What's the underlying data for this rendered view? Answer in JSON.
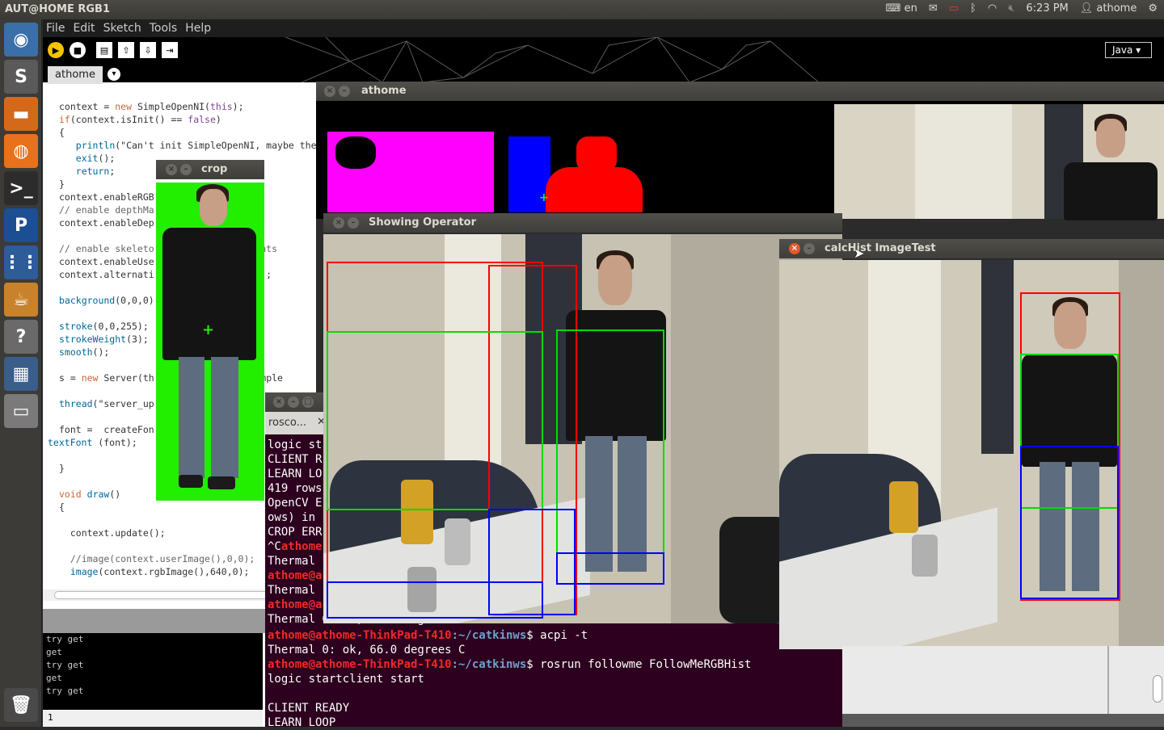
{
  "top_panel": {
    "title": "AUT@HOME RGB1",
    "lang": "en",
    "time": "6:23 PM",
    "user": "athome"
  },
  "launcher": [
    {
      "name": "dash",
      "glyph": "◉",
      "bg": "#3a6fa8"
    },
    {
      "name": "sublime",
      "glyph": "S",
      "bg": "#5a5a5a"
    },
    {
      "name": "files",
      "glyph": "▬",
      "bg": "#d4691c"
    },
    {
      "name": "firefox",
      "glyph": "◍",
      "bg": "#e8711c"
    },
    {
      "name": "terminal",
      "glyph": ">_",
      "bg": "#2c2c2c"
    },
    {
      "name": "processing",
      "glyph": "P",
      "bg": "#1c4e94"
    },
    {
      "name": "apps",
      "glyph": "⋮⋮",
      "bg": "#2d5c98"
    },
    {
      "name": "java",
      "glyph": "☕",
      "bg": "#c9822c"
    },
    {
      "name": "help",
      "glyph": "?",
      "bg": "#6a6a6a"
    },
    {
      "name": "workspace",
      "glyph": "▦",
      "bg": "#3a5d8a"
    },
    {
      "name": "drive",
      "glyph": "▭",
      "bg": "#7a7a7a"
    },
    {
      "name": "trash",
      "glyph": "🗑",
      "bg": "#4a4a4a"
    }
  ],
  "menu": [
    "File",
    "Edit",
    "Sketch",
    "Tools",
    "Help"
  ],
  "mode": "Java",
  "sketch_tab": "athome",
  "code": [
    "context = new SimpleOpenNI(this);",
    "if(context.isInit() == false)",
    "{",
    "   println(\"Can't init SimpleOpenNI, maybe the",
    "   exit();",
    "   return;",
    "}",
    "context.enableRGB",
    "// enable depthMa",
    "context.enableDep",
    "",
    "// enable skeleto              l joints",
    "context.enableUse",
    "context.alternati              mage();",
    "",
    "background(0,0,0)",
    "",
    "stroke(0,0,255);",
    "strokeWeight(3);",
    "smooth();",
    "",
    "s = new Server(th             t a simple",
    "",
    "thread(\"server_up",
    "",
    "font =  createFon",
    "textFont (font);",
    "",
    "}",
    "",
    "void draw()",
    "{",
    "",
    "  context.update();",
    "",
    "  //image(context.userImage(),0,0);",
    "  image(context.rgbImage(),640,0);"
  ],
  "console": [
    "try get",
    "get",
    "try get",
    "get",
    "try get"
  ],
  "line_number": "1",
  "windows": {
    "crop": "crop",
    "athome": "athome",
    "showing": "Showing Operator",
    "calc": "calcHist ImageTest",
    "terminal_tab": "rosco..."
  },
  "terminal_partial": [
    "logic st",
    "CLIENT R",
    "LEARN LO",
    "419 rows",
    "OpenCV E",
    "ows) in",
    "CROP ERR",
    "^Cathome",
    "Thermal",
    "athome@a",
    "Thermal",
    "athome@a",
    "Thermal 0: ok, 67.0 degrees C"
  ],
  "terminal_full": [
    {
      "user": "athome@athome-ThinkPad-T410",
      "path": ":~/catkinws",
      "cmd": "$ acpi -t"
    },
    {
      "text": "Thermal 0: ok, 66.0 degrees C"
    },
    {
      "user": "athome@athome-ThinkPad-T410",
      "path": ":~/catkinws",
      "cmd": "$ rosrun followme FollowMeRGBHist"
    },
    {
      "text": "logic startclient start"
    },
    {
      "text": ""
    },
    {
      "text": "CLIENT READY"
    },
    {
      "text": "LEARN LOOP"
    }
  ]
}
